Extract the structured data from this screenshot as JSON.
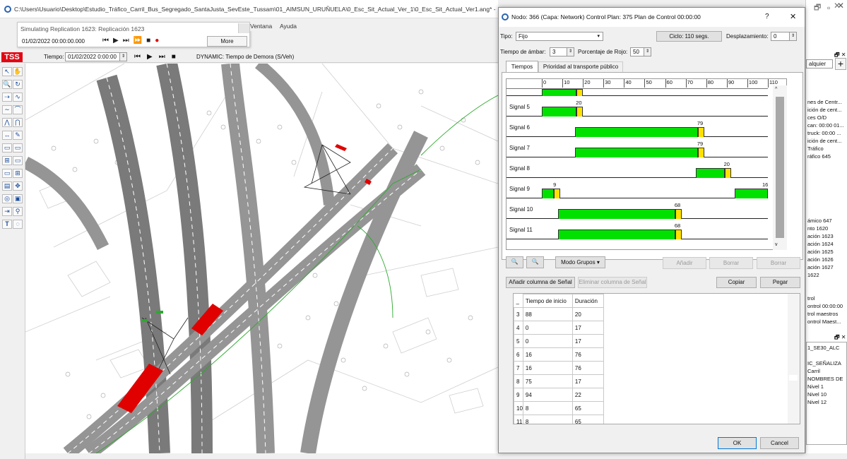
{
  "window_title": "C:\\Users\\Usuario\\Desktop\\Estudio_Tráfico_Carril_Bus_Segregado_SantaJusta_SevEste_Tussam\\01_AIMSUN_URUÑUELA\\0_Esc_Sit_Actual_Ver_1\\0_Esc_Sit_Actual_Ver1.ang* - ",
  "sim": {
    "title": "Simulating Replication 1623: Replicación 1623",
    "datetime": "01/02/2022 00:00:00.000",
    "more": "More"
  },
  "menu": [
    "Ventana",
    "Ayuda"
  ],
  "tssbar": {
    "logo": "TSS",
    "time_label": "Tiempo:",
    "time_value": "01/02/2022 0:00:00",
    "mode": "DYNAMIC: Tiempo de Demora (S/Veh)"
  },
  "toolbar_icons": [
    "pointer-icon",
    "hand-icon",
    "zoom-icon",
    "rotate-icon",
    "node-icon",
    "polyline-icon",
    "curve-icon",
    "arc-icon",
    "arc2-icon",
    "node2-icon",
    "pen-icon",
    "rect-icon",
    "rect2-icon",
    "detector-icon",
    "meter-icon",
    "centroid-icon",
    "section-icon",
    "grid-icon",
    "grid2-icon",
    "move-icon",
    "circle-icon",
    "image-icon",
    "vms-icon",
    "pedestrian-icon",
    "text-icon",
    "polygon-icon"
  ],
  "dialog": {
    "title": "Nodo: 366 (Capa: Network) Control Plan: 375 Plan de Control 00:00:00",
    "help": "?",
    "close": "✕",
    "tipo_label": "Tipo:",
    "tipo_value": "Fijo",
    "ciclo": "Ciclo: 110 segs.",
    "desplazamiento_label": "Desplazamiento:",
    "desplazamiento_value": "0",
    "ambar_label": "Tiempo de ámbar:",
    "ambar_value": "3",
    "rojo_label": "Porcentaje de Rojo:",
    "rojo_value": "50",
    "tabs": [
      "Tiempos",
      "Prioridad al transporte público"
    ],
    "ruler": [
      "0",
      "10",
      "20",
      "30",
      "40",
      "50",
      "60",
      "70",
      "80",
      "90",
      "100",
      "110"
    ],
    "cycle": 110,
    "signals": [
      {
        "label": "",
        "bars": [
          {
            "start": 0,
            "end": 17
          }
        ],
        "amber": [
          17,
          20
        ]
      },
      {
        "label": "Signal 5",
        "bars": [
          {
            "start": 0,
            "end": 17
          }
        ],
        "amber": [
          17,
          20
        ],
        "marks": [
          "20"
        ]
      },
      {
        "label": "Signal 6",
        "bars": [
          {
            "start": 16,
            "end": 76
          }
        ],
        "amber": [
          76,
          79
        ],
        "marks": [
          "79"
        ]
      },
      {
        "label": "Signal 7",
        "bars": [
          {
            "start": 16,
            "end": 76
          }
        ],
        "amber": [
          76,
          79
        ],
        "marks": [
          "79"
        ]
      },
      {
        "label": "Signal 8",
        "bars": [
          {
            "start": 75,
            "end": 89
          }
        ],
        "amber": [
          89,
          92
        ],
        "marks": [
          "20"
        ]
      },
      {
        "label": "Signal 9",
        "bars": [
          {
            "start": 0,
            "end": 6
          },
          {
            "start": 94,
            "end": 110
          }
        ],
        "amber": [
          6,
          9
        ],
        "marks": [
          "9",
          "16"
        ]
      },
      {
        "label": "Signal 10",
        "bars": [
          {
            "start": 8,
            "end": 65
          }
        ],
        "amber": [
          65,
          68
        ],
        "marks": [
          "68"
        ]
      },
      {
        "label": "Signal 11",
        "bars": [
          {
            "start": 8,
            "end": 65
          }
        ],
        "amber": [
          65,
          68
        ],
        "marks": [
          "68"
        ]
      }
    ],
    "modo_grupos": "Modo Grupos",
    "anadir": "Añadir",
    "borrar": "Borrar",
    "borrar2": "Borrar",
    "add_col": "Añadir columna de Señal",
    "del_col": "Eliminar columna de Señal",
    "copiar": "Copiar",
    "pegar": "Pegar",
    "table": {
      "headers": [
        "Tiempo de inicio",
        "Duración"
      ],
      "rows": [
        {
          "n": "3",
          "start": "88",
          "dur": "20"
        },
        {
          "n": "4",
          "start": "0",
          "dur": "17"
        },
        {
          "n": "5",
          "start": "0",
          "dur": "17"
        },
        {
          "n": "6",
          "start": "16",
          "dur": "76"
        },
        {
          "n": "7",
          "start": "16",
          "dur": "76"
        },
        {
          "n": "8",
          "start": "75",
          "dur": "17"
        },
        {
          "n": "9",
          "start": "94",
          "dur": "22"
        },
        {
          "n": "10",
          "start": "8",
          "dur": "65"
        },
        {
          "n": "11",
          "start": "8",
          "dur": "65"
        }
      ]
    },
    "ok": "OK",
    "cancel": "Cancel"
  },
  "right_panel": {
    "combo": "alquier",
    "top_items": [
      "nes de Centr...",
      "ición de cent...",
      "ces O/D",
      "can: 00:00 01...",
      "truck: 00:00 ...",
      "ición de cent...",
      "Tráfico",
      "ráfico 645"
    ],
    "mid_items": [
      "ámico 647",
      "nto 1620",
      "ación 1623",
      "ación 1624",
      "ación 1625",
      "ación 1626",
      "ación 1627",
      "1622"
    ],
    "ctrl_items": [
      "trol",
      "ontrol 00:00:00",
      "trol maestros",
      "ontrol Maest..."
    ],
    "bottom_items": [
      "1_SE30_ALC",
      "",
      "IC_SEÑALIZA",
      "Carril",
      "NOMBRES DE",
      "Nivel 1",
      "Nivel 10",
      "Nivel 12"
    ]
  }
}
